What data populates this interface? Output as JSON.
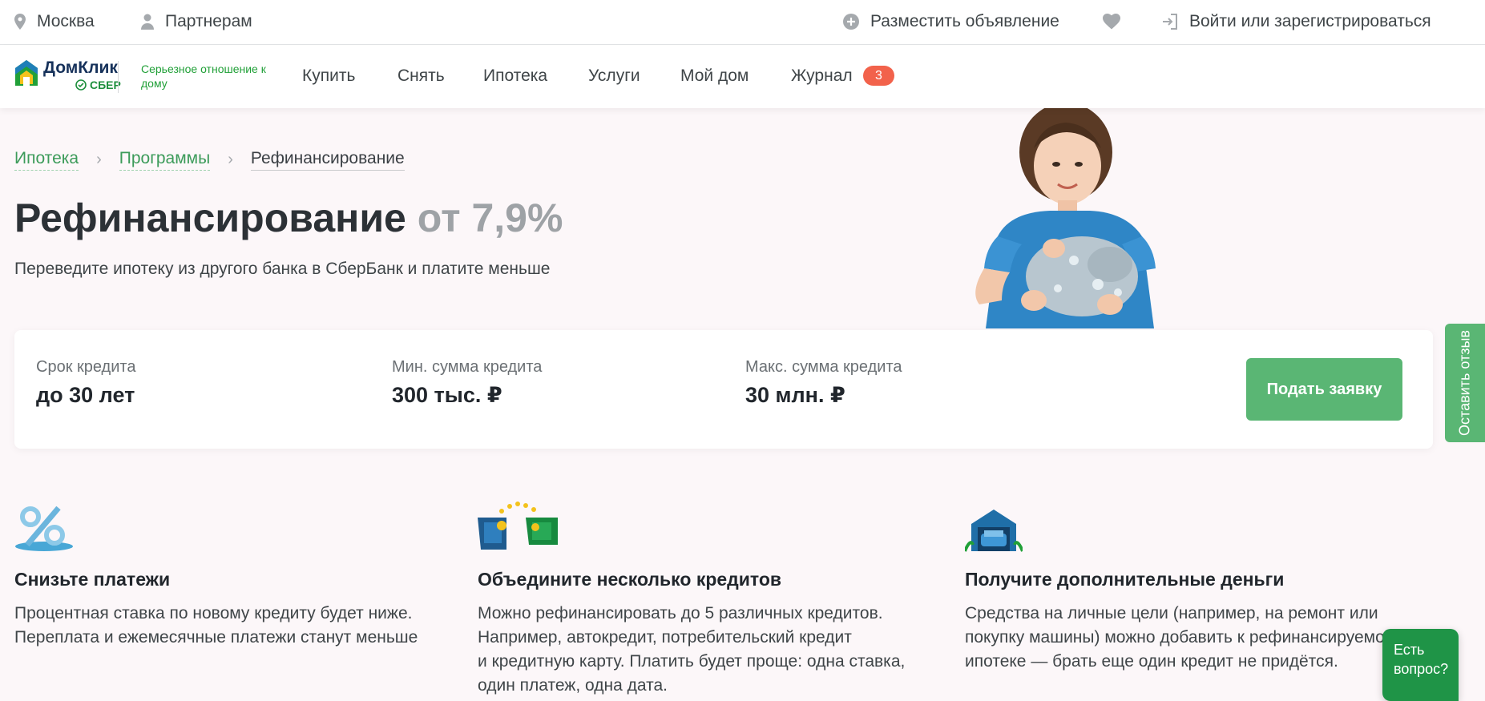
{
  "topbar": {
    "city": "Москва",
    "partners": "Партнерам",
    "post_ad": "Разместить объявление",
    "login": "Войти или зарегистрироваться"
  },
  "logo": {
    "name": "ДомКлик",
    "sber": "СБЕР",
    "slogan": "Серьезное отношение к дому"
  },
  "nav": {
    "items": [
      {
        "label": "Купить"
      },
      {
        "label": "Снять"
      },
      {
        "label": "Ипотека"
      },
      {
        "label": "Услуги"
      },
      {
        "label": "Мой дом"
      },
      {
        "label": "Журнал",
        "badge": "3"
      }
    ]
  },
  "breadcrumb": {
    "items": [
      "Ипотека",
      "Программы"
    ],
    "current": "Рефинансирование"
  },
  "hero": {
    "title": "Рефинансирование",
    "rate": "от 7,9%",
    "subtitle": "Переведите ипотеку из другого банка в СберБанк и платите меньше"
  },
  "card": {
    "stats": [
      {
        "label": "Срок кредита",
        "value": "до 30 лет"
      },
      {
        "label": "Мин. сумма кредита",
        "value": "300 тыс. ₽"
      },
      {
        "label": "Макс. сумма кредита",
        "value": "30 млн. ₽"
      }
    ],
    "apply_label": "Подать заявку"
  },
  "feedback": {
    "label": "Оставить отзыв"
  },
  "features": [
    {
      "icon": "percent-icon",
      "title": "Снизьте платежи",
      "text": "Процентная ставка по новому кредиту будет ниже.\nПереплата и ежемесячные платежи станут меньше"
    },
    {
      "icon": "wallets-icon",
      "title": "Объедините несколько кредитов",
      "text": "Можно рефинансировать до 5 различных кредитов.\nНапример, автокредит, потребительский кредит\nи кредитную карту. Платить будет проще: одна ставка,\nодин платеж, одна дата."
    },
    {
      "icon": "garage-car-icon",
      "title": "Получите дополнительные деньги",
      "text": "Средства на личные цели (например, на ремонт или\nпокупку машины) можно добавить к рефинансируемой\nипотеке — брать еще один кредит не придётся."
    }
  ],
  "chat": {
    "label": "Есть вопрос?"
  },
  "colors": {
    "accent": "#5ab674",
    "link": "#3c9b5a",
    "badge": "#f2624b",
    "hero_bg": "#fcf7f9"
  }
}
